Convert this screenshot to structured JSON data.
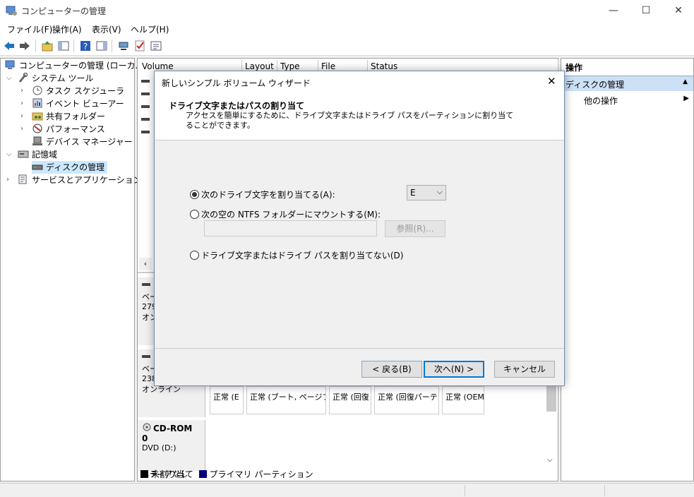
{
  "window": {
    "title": "コンピューターの管理",
    "minimize": "—",
    "maximize": "☐",
    "close": "✕"
  },
  "menu": [
    "ファイル(F)",
    "操作(A)",
    "表示(V)",
    "ヘルプ(H)"
  ],
  "tree": {
    "root": "コンピューターの管理 (ローカル)",
    "system_tools": "システム ツール",
    "task_scheduler": "タスク スケジューラ",
    "event_viewer": "イベント ビューアー",
    "shared_folders": "共有フォルダー",
    "performance": "パフォーマンス",
    "device_manager": "デバイス マネージャー",
    "storage": "記憶域",
    "disk_management": "ディスクの管理",
    "services": "サービスとアプリケーション"
  },
  "columns": [
    "Volume",
    "Layout",
    "Type",
    "File System",
    "Status"
  ],
  "disks": {
    "disk0_l1": "ベー",
    "disk0_l2": "279",
    "disk0_l3": "オン",
    "disk1_l1": "ベー",
    "disk1_l2": "238",
    "disk1_l3": "オンライン",
    "partitions": [
      "正常 (E",
      "正常 (ブート, ページフ",
      "正常 (回復",
      "正常 (回復パーテ",
      "正常 (OEM"
    ],
    "cdrom_name": "CD-ROM 0",
    "cdrom_drive": "DVD (D:)",
    "cdrom_media": "メディアなし"
  },
  "legend": {
    "unallocated": "未割り当て",
    "primary": "プライマリ パーティション"
  },
  "actions": {
    "header": "操作",
    "section": "ディスクの管理",
    "more": "他の操作"
  },
  "dialog": {
    "title": "新しいシンプル ボリューム ウィザード",
    "heading": "ドライブ文字またはパスの割り当て",
    "description": "アクセスを簡単にするために、ドライブ文字またはドライブ パスをパーティションに割り当てることができます。",
    "opt_letter": "次のドライブ文字を割り当てる(A):",
    "letter_value": "E",
    "opt_folder": "次の空の NTFS フォルダーにマウントする(M):",
    "browse": "参照(R)...",
    "opt_none": "ドライブ文字またはドライブ パスを割り当てない(D)",
    "back": "< 戻る(B)",
    "next": "次へ(N) >",
    "cancel": "キャンセル"
  },
  "colors": {
    "accent": "#0078d7",
    "unallocated": "#000000",
    "primary": "#00007f"
  }
}
